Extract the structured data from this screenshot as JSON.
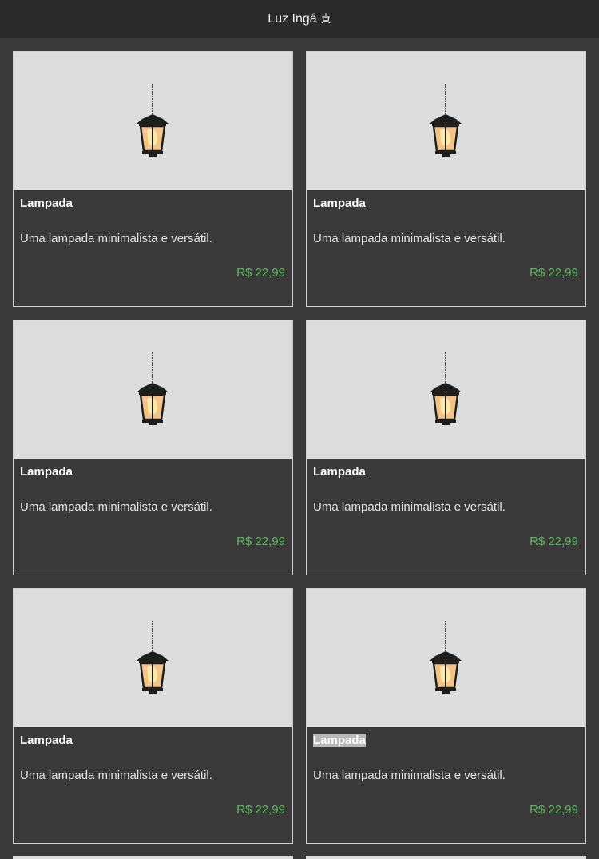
{
  "header": {
    "title": "Luz Ingá",
    "icon": "hanging-lamp-icon"
  },
  "colors": {
    "background": "#3a3a3a",
    "header": "#2b2b2b",
    "price": "#5cb85c",
    "image_bg": "#dcdcdc"
  },
  "products": [
    {
      "name": "Lampada",
      "description": "Uma lampada minimalista e versátil.",
      "price": "R$ 22,99",
      "image": "lantern-image"
    },
    {
      "name": "Lampada",
      "description": "Uma lampada minimalista e versátil.",
      "price": "R$ 22,99",
      "image": "lantern-image"
    },
    {
      "name": "Lampada",
      "description": "Uma lampada minimalista e versátil.",
      "price": "R$ 22,99",
      "image": "lantern-image"
    },
    {
      "name": "Lampada",
      "description": "Uma lampada minimalista e versátil.",
      "price": "R$ 22,99",
      "image": "lantern-image"
    },
    {
      "name": "Lampada",
      "description": "Uma lampada minimalista e versátil.",
      "price": "R$ 22,99",
      "image": "lantern-image"
    },
    {
      "name": "Lampada",
      "description": "Uma lampada minimalista e versátil.",
      "price": "R$ 22,99",
      "image": "lantern-image"
    }
  ]
}
